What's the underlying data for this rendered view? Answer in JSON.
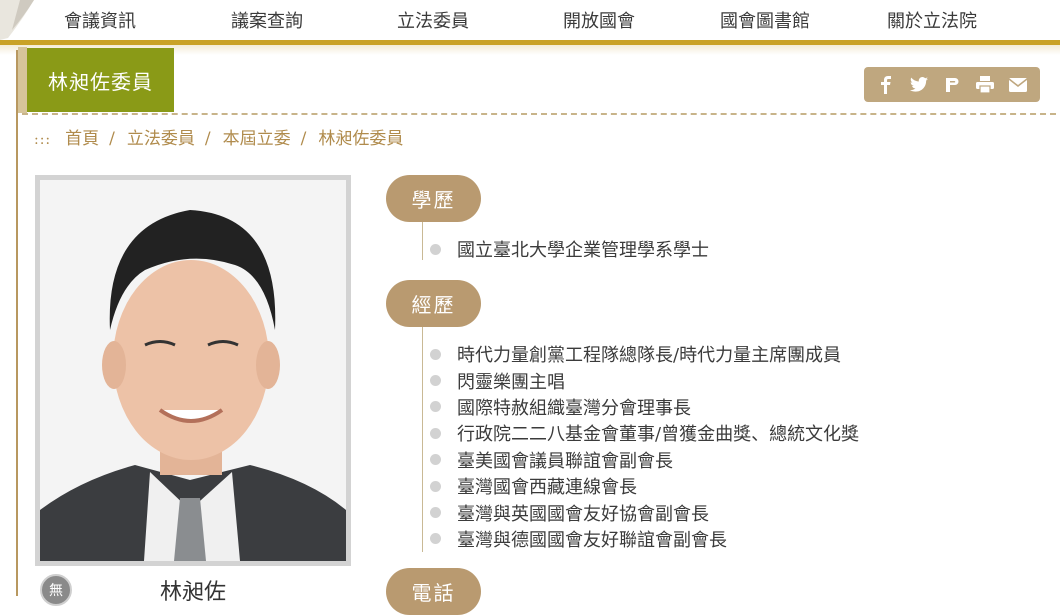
{
  "nav": {
    "items": [
      "會議資訊",
      "議案查詢",
      "立法委員",
      "開放國會",
      "國會圖書館",
      "關於立法院"
    ]
  },
  "page": {
    "title": "林昶佐委員"
  },
  "share": {
    "icons": [
      "facebook-icon",
      "twitter-icon",
      "plurk-icon",
      "print-icon",
      "mail-icon"
    ]
  },
  "breadcrumb": {
    "marker": ":::",
    "items": [
      "首頁",
      "立法委員",
      "本屆立委",
      "林昶佐委員"
    ]
  },
  "profile": {
    "party_badge": "無",
    "name": "林昶佐"
  },
  "education": {
    "label": "學歷",
    "items": [
      "國立臺北大學企業管理學系學士"
    ]
  },
  "experience": {
    "label": "經歷",
    "items": [
      "時代力量創黨工程隊總隊長/時代力量主席團成員",
      "閃靈樂團主唱",
      "國際特赦組織臺灣分會理事長",
      "行政院二二八基金會董事/曾獲金曲獎、總統文化獎",
      "臺美國會議員聯誼會副會長",
      "臺灣國會西藏連線會長",
      "臺灣與英國國會友好協會副會長",
      "臺灣與德國國會友好聯誼會副會長"
    ]
  },
  "phone": {
    "label": "電話"
  },
  "colors": {
    "accent_gold": "#c9a227",
    "title_green": "#8a9a17",
    "pill_tan": "#b99a70",
    "link_brown": "#b08b4c"
  }
}
